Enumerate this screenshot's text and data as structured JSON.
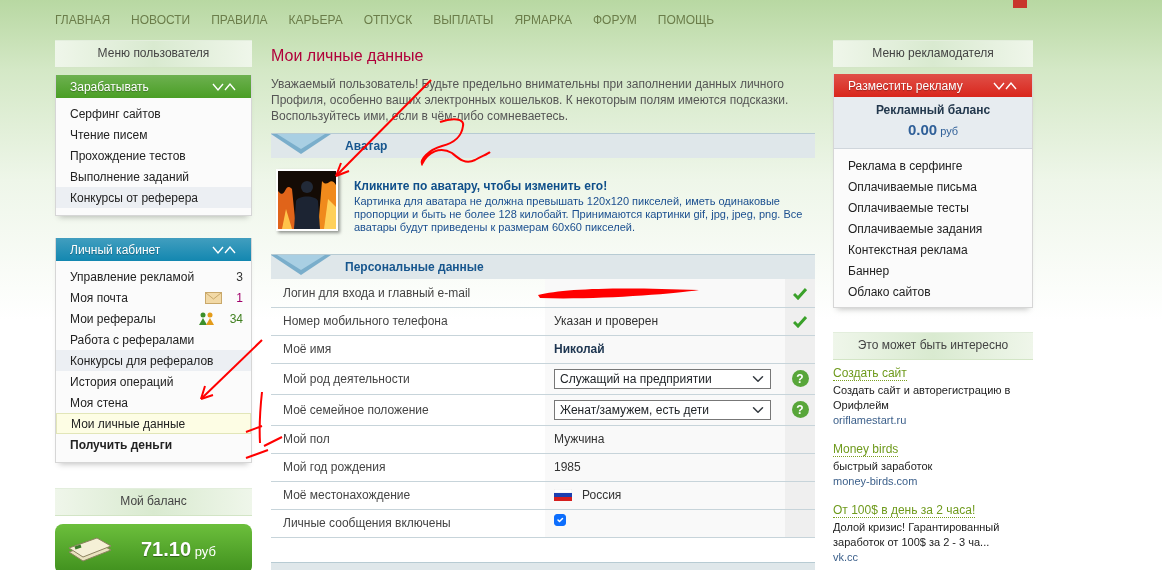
{
  "top_nav": [
    {
      "label": "ГЛАВНАЯ"
    },
    {
      "label": "НОВОСТИ"
    },
    {
      "label": "ПРАВИЛА"
    },
    {
      "label": "КАРЬЕРА"
    },
    {
      "label": "ОТПУСК"
    },
    {
      "label": "ВЫПЛАТЫ"
    },
    {
      "label": "ЯРМАРКА"
    },
    {
      "label": "ФОРУМ"
    },
    {
      "label": "ПОМОЩЬ"
    }
  ],
  "left_sidebar": {
    "title": "Меню пользователя",
    "panels": [
      {
        "title": "Зарабатывать",
        "color": "#4a9e25",
        "items": [
          {
            "label": "Серфинг сайтов",
            "selected": false,
            "highlighted": false,
            "bold": false
          },
          {
            "label": "Чтение писем",
            "selected": false,
            "highlighted": false,
            "bold": false
          },
          {
            "label": "Прохождение тестов",
            "selected": false,
            "highlighted": false,
            "bold": false
          },
          {
            "label": "Выполнение заданий",
            "selected": false,
            "highlighted": false,
            "bold": false
          },
          {
            "label": "Конкурсы от реферера",
            "selected": false,
            "highlighted": true,
            "bold": false
          }
        ]
      },
      {
        "title": "Личный кабинет",
        "color": "#1387b0",
        "items": [
          {
            "label": "Управление рекламой",
            "selected": false,
            "highlighted": false,
            "bold": false,
            "kind": "plain",
            "count": "3",
            "color": "#333333"
          },
          {
            "label": "Моя почта",
            "selected": false,
            "highlighted": false,
            "bold": false,
            "kind": "mail",
            "count": "1",
            "color": "#a0006a"
          },
          {
            "label": "Мои рефералы",
            "selected": false,
            "highlighted": false,
            "bold": false,
            "kind": "referrals",
            "count": "34",
            "color": "#3f7f1f"
          },
          {
            "label": "Работа с рефералами",
            "selected": false,
            "highlighted": false,
            "bold": false
          },
          {
            "label": "Конкурсы для рефералов",
            "selected": false,
            "highlighted": true,
            "bold": false
          },
          {
            "label": "История операций",
            "selected": false,
            "highlighted": false,
            "bold": false
          },
          {
            "label": "Моя стена",
            "selected": false,
            "highlighted": false,
            "bold": false
          },
          {
            "label": "Мои личные данные",
            "selected": true,
            "highlighted": false,
            "bold": false
          },
          {
            "label": "Получить деньги",
            "selected": false,
            "highlighted": false,
            "bold": true
          }
        ]
      }
    ],
    "balance": {
      "title": "Мой баланс",
      "amount": "71.10",
      "currency": "руб"
    }
  },
  "main": {
    "title": "Мои личные данные",
    "intro": "Уважаемый пользователь! Будьте предельно внимательны при заполнении данных личного Профиля, особенно ваших электронных кошельков. К некоторым полям имеются подсказки. Воспользуйтесь ими, если в чём-либо сомневаетесь.",
    "avatar_section": {
      "title": "Аватар",
      "link": "Кликните по аватару, чтобы изменить его!",
      "description": "Картинка для аватара не должна превышать 120x120 пикселей, иметь одинаковые пропорции и быть не более 128 килобайт. Принимаются картинки gif, jpg, jpeg, png. Все аватары будут приведены к размерам 60x60 пикселей."
    },
    "personal_section": {
      "title": "Персональные данные",
      "rows": [
        {
          "label": "Логин для входа и главный e-mail",
          "kind": "redacted",
          "verified": true
        },
        {
          "label": "Номер мобильного телефона",
          "kind": "text",
          "value": "Указан и проверен",
          "verified": true
        },
        {
          "label": "Моё имя",
          "kind": "bold",
          "value": "Николай",
          "verified": false
        },
        {
          "label": "Мой род деятельности",
          "kind": "select",
          "value": "Служащий на предприятии",
          "verified": false,
          "help": "?"
        },
        {
          "label": "Моё семейное положение",
          "kind": "select",
          "value": "Женат/замужем, есть дети",
          "verified": false,
          "help": "?"
        },
        {
          "label": "Мой пол",
          "kind": "text",
          "value": "Мужчина",
          "verified": false
        },
        {
          "label": "Мой год рождения",
          "kind": "text",
          "value": "1985",
          "verified": false
        },
        {
          "label": "Моё местонахождение",
          "kind": "flag",
          "value": "Россия",
          "verified": false
        },
        {
          "label": "Личные сообщения включены",
          "kind": "checkbox",
          "checked": true,
          "verified": false
        }
      ]
    }
  },
  "right_sidebar": {
    "title": "Меню рекламодателя",
    "panel": {
      "title": "Разместить рекламу",
      "color": "#d9261c",
      "balance_label": "Рекламный баланс",
      "balance_amount": "0.00",
      "currency": "руб",
      "items": [
        {
          "label": "Реклама в серфинге"
        },
        {
          "label": "Оплачиваемые письма"
        },
        {
          "label": "Оплачиваемые тесты"
        },
        {
          "label": "Оплачиваемые задания"
        },
        {
          "label": "Контекстная реклама"
        },
        {
          "label": "Баннер"
        },
        {
          "label": "Облако сайтов"
        }
      ]
    },
    "suggestions": {
      "title": "Это может быть интересно",
      "ads": [
        {
          "title": "Создать сайт",
          "description": "Создать сайт и авторегистрацию в Орифлейм",
          "url": "oriflamestart.ru"
        },
        {
          "title": "Money birds",
          "description": "быстрый заработок",
          "url": "money-birds.com"
        },
        {
          "title": "От 100$ в день за 2 часа!",
          "description": "Долой кризис! Гарантированный заработок от 100$ за 2 - 3 ча...",
          "url": "vk.cc"
        }
      ]
    }
  }
}
